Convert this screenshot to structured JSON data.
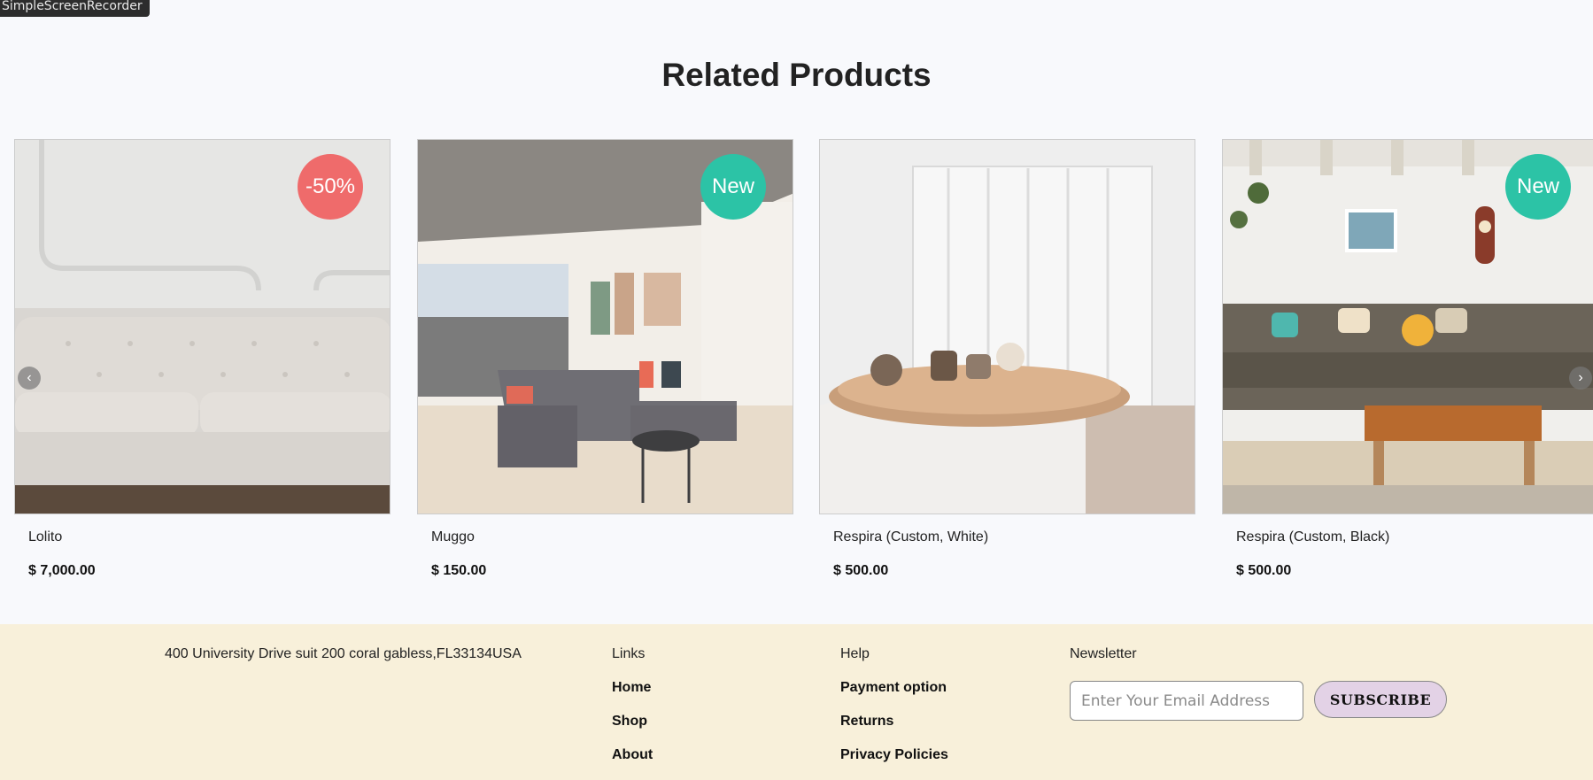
{
  "recorder": {
    "label": "SimpleScreenRecorder"
  },
  "section": {
    "title": "Related Products"
  },
  "products": [
    {
      "name": "Lolito",
      "price": "$ 7,000.00",
      "badge": "-50%",
      "badge_color": "#ef6b6b"
    },
    {
      "name": "Muggo",
      "price": "$ 150.00",
      "badge": "New",
      "badge_color": "#2cc3a6"
    },
    {
      "name": "Respira (Custom, White)",
      "price": "$ 500.00",
      "badge": "",
      "badge_color": ""
    },
    {
      "name": "Respira (Custom, Black)",
      "price": "$ 500.00",
      "badge": "New",
      "badge_color": "#2cc3a6"
    }
  ],
  "carousel": {
    "prev_icon": "‹",
    "next_icon": "›"
  },
  "footer": {
    "address": "400 University Drive suit 200 coral gabless,FL33134USA",
    "links": {
      "heading": "Links",
      "items": [
        "Home",
        "Shop",
        "About"
      ]
    },
    "help": {
      "heading": "Help",
      "items": [
        "Payment option",
        "Returns",
        "Privacy Policies"
      ]
    },
    "newsletter": {
      "heading": "Newsletter",
      "placeholder": "Enter Your Email Address",
      "button": "SUBSCRIBE"
    }
  }
}
